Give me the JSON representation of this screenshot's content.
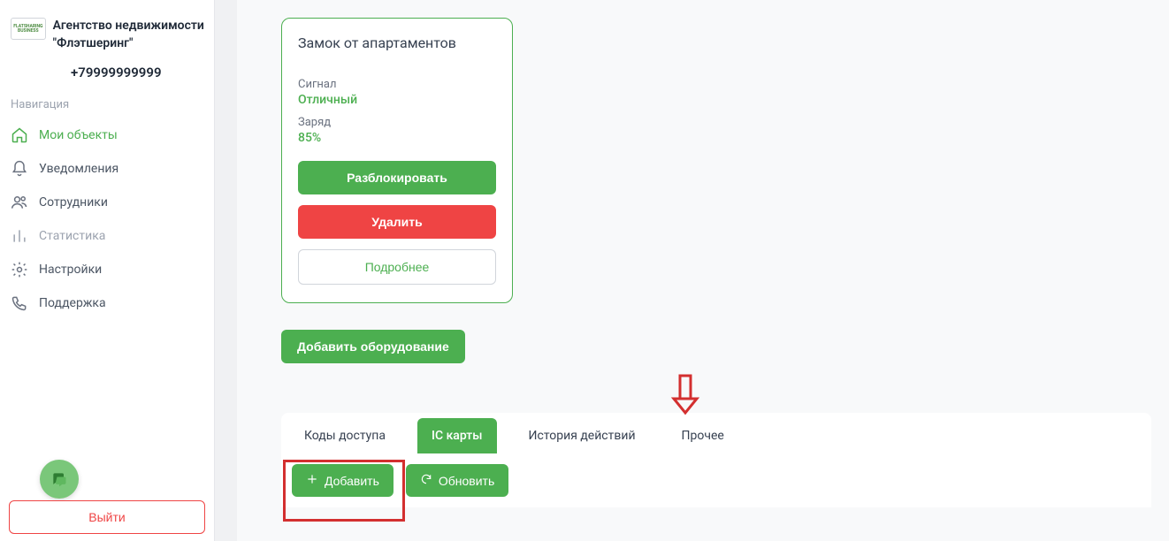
{
  "sidebar": {
    "org_name": "Агентство недвижимости \"Флэтшеринг\"",
    "phone": "+79999999999",
    "nav_label": "Навигация",
    "items": [
      {
        "label": "Мои объекты"
      },
      {
        "label": "Уведомления"
      },
      {
        "label": "Сотрудники"
      },
      {
        "label": "Статистика"
      },
      {
        "label": "Настройки"
      },
      {
        "label": "Поддержка"
      }
    ],
    "logout": "Выйти"
  },
  "card": {
    "title": "Замок от апартаментов",
    "signal_label": "Сигнал",
    "signal_value": "Отличный",
    "charge_label": "Заряд",
    "charge_value": "85%",
    "unlock_btn": "Разблокировать",
    "delete_btn": "Удалить",
    "details_btn": "Подробнее"
  },
  "add_equipment_btn": "Добавить оборудование",
  "tabs": [
    {
      "label": "Коды доступа"
    },
    {
      "label": "IC карты"
    },
    {
      "label": "История действий"
    },
    {
      "label": "Прочее"
    }
  ],
  "actions": {
    "add": "Добавить",
    "refresh": "Обновить"
  }
}
